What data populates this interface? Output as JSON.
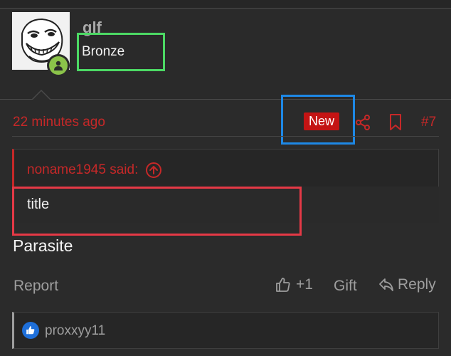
{
  "user": {
    "username": "glf",
    "rank": "Bronze"
  },
  "post": {
    "timestamp": "22 minutes ago",
    "new_badge": "New",
    "number": "#7",
    "quote_author": "noname1945 said:",
    "quote_text": "title",
    "body": "Parasite"
  },
  "actions": {
    "report": "Report",
    "like_count": "+1",
    "gift": "Gift",
    "reply": "Reply"
  },
  "likes": {
    "user": "proxxyy11"
  },
  "colors": {
    "accent_red": "#c62828",
    "new_badge": "#c41414",
    "online_green": "#8bc34a",
    "highlight_green": "#4cd964",
    "highlight_blue": "#1e88e5",
    "highlight_red": "#e53946",
    "like_blue": "#1e6fd9"
  }
}
